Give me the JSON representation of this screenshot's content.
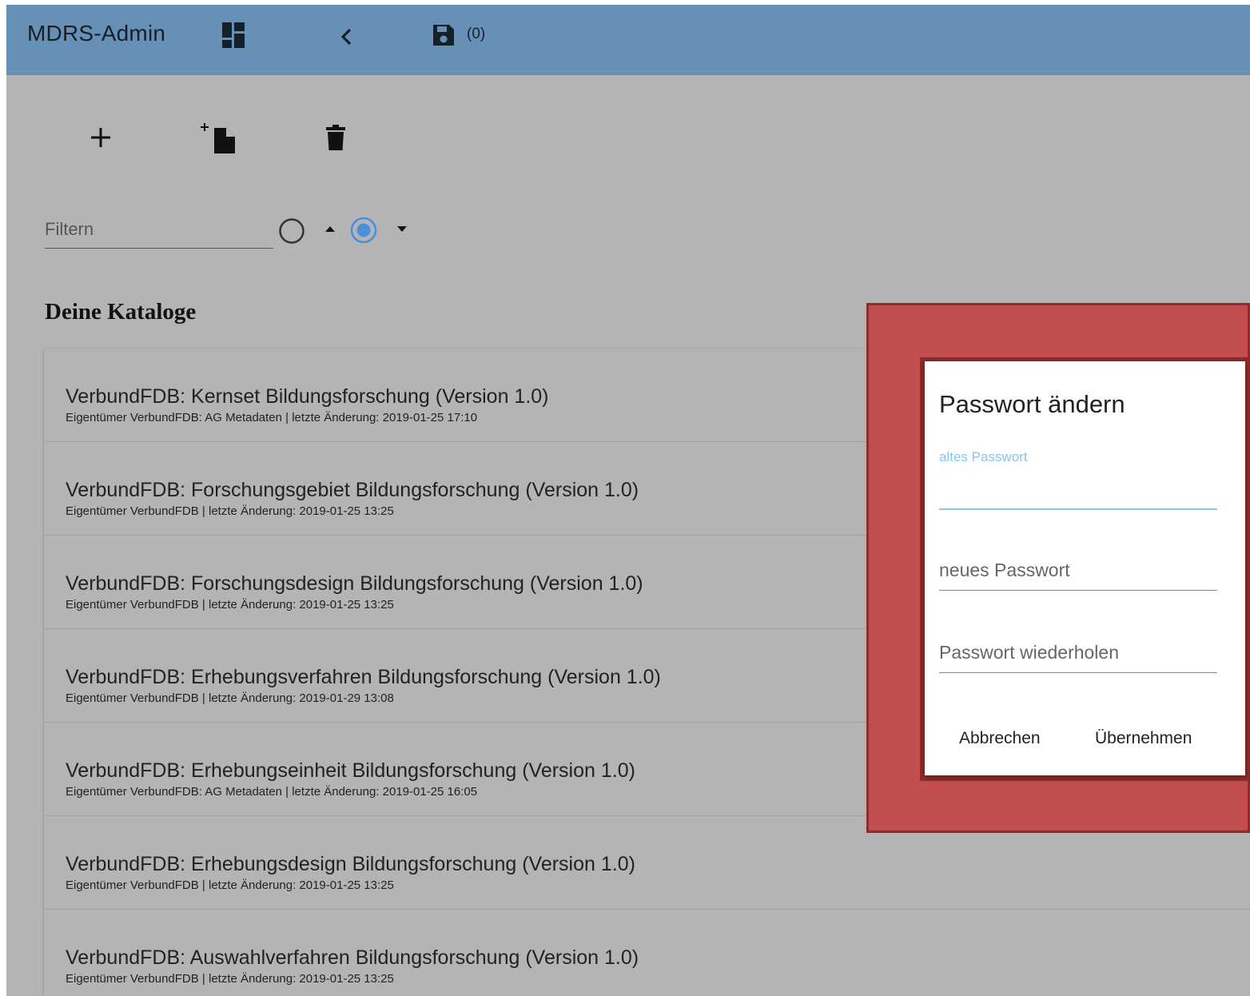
{
  "topbar": {
    "title": "MDRS-Admin",
    "dashboard_icon": "dashboard-icon",
    "back_icon": "chevron-left-icon",
    "save_icon": "save-icon",
    "save_count": "(0)"
  },
  "toolbar": {
    "add_icon": "plus-icon",
    "new_doc_icon": "new-document-icon",
    "delete_icon": "trash-icon"
  },
  "filter": {
    "placeholder": "Filtern",
    "sort_ascending_selected": false,
    "sort_descending_selected": true
  },
  "section_title": "Deine Kataloge",
  "catalogs": [
    {
      "title": "VerbundFDB: Kernset Bildungsforschung (Version 1.0)",
      "subtitle": "Eigentümer VerbundFDB: AG Metadaten | letzte Änderung: 2019-01-25 17:10"
    },
    {
      "title": "VerbundFDB: Forschungsgebiet Bildungsforschung (Version 1.0)",
      "subtitle": "Eigentümer VerbundFDB | letzte Änderung: 2019-01-25 13:25"
    },
    {
      "title": "VerbundFDB: Forschungsdesign Bildungsforschung (Version 1.0)",
      "subtitle": "Eigentümer VerbundFDB | letzte Änderung: 2019-01-25 13:25"
    },
    {
      "title": "VerbundFDB: Erhebungsverfahren Bildungsforschung (Version 1.0)",
      "subtitle": "Eigentümer VerbundFDB | letzte Änderung: 2019-01-29 13:08"
    },
    {
      "title": "VerbundFDB: Erhebungseinheit Bildungsforschung (Version 1.0)",
      "subtitle": "Eigentümer VerbundFDB: AG Metadaten | letzte Änderung: 2019-01-25 16:05"
    },
    {
      "title": "VerbundFDB: Erhebungsdesign Bildungsforschung (Version 1.0)",
      "subtitle": "Eigentümer VerbundFDB | letzte Änderung: 2019-01-25 13:25"
    },
    {
      "title": "VerbundFDB: Auswahlverfahren Bildungsforschung (Version 1.0)",
      "subtitle": "Eigentümer VerbundFDB | letzte Änderung: 2019-01-25 13:25"
    }
  ],
  "dialog": {
    "title": "Passwort ändern",
    "old_password_label": "altes Passwort",
    "new_password_placeholder": "neues Passwort",
    "repeat_password_placeholder": "Passwort wiederholen",
    "cancel_label": "Abbrechen",
    "apply_label": "Übernehmen"
  },
  "colors": {
    "header_bg": "#6690b5",
    "page_bg": "#b4b4b4",
    "highlight_fill": "#c24f4e",
    "highlight_border": "#8d2c2c",
    "accent": "#88c4ee",
    "radio_selected": "#4a90d9"
  }
}
